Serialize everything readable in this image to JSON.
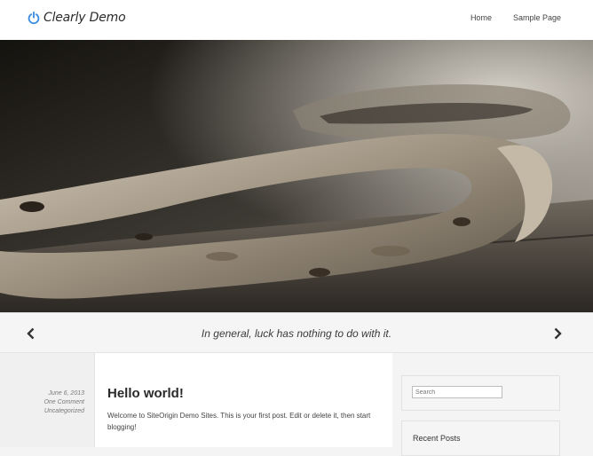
{
  "header": {
    "site_title": "Clearly Demo",
    "logo_icon": "power-icon",
    "accent_color": "#3d8ee0",
    "nav": [
      {
        "label": "Home"
      },
      {
        "label": "Sample Page"
      }
    ]
  },
  "hero": {
    "image": "horseshoe-photo",
    "caption": "In general, luck has nothing to do with it.",
    "prev_icon": "chevron-left-icon",
    "next_icon": "chevron-right-icon"
  },
  "post": {
    "date": "June 6, 2013",
    "comments": "One Comment",
    "category": "Uncategorized",
    "title": "Hello world!",
    "excerpt": "Welcome to SiteOrigin Demo Sites. This is your first post. Edit or delete it, then start blogging!"
  },
  "sidebar": {
    "search_placeholder": "Search",
    "recent_posts_title": "Recent Posts"
  }
}
